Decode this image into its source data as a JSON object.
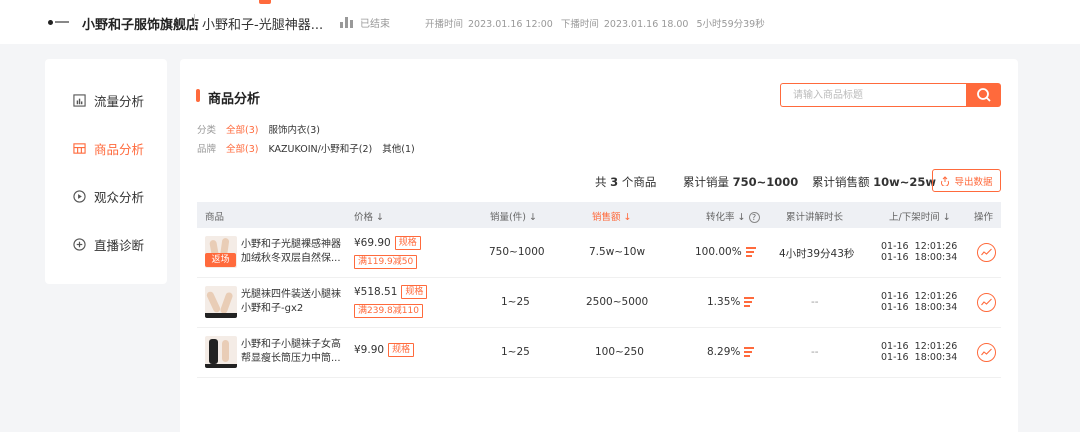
{
  "header": {
    "shop_name": "小野和子服饰旗舰店",
    "live_title": "小野和子-光腿神器...",
    "status": "已结束",
    "start_label": "开播时间",
    "start_time": "2023.01.16 12:00",
    "end_label": "下播时间",
    "end_time": "2023.01.16 18.00",
    "duration": "5小时59分39秒"
  },
  "sidebar": {
    "items": [
      {
        "label": "流量分析",
        "icon": "chart-box-icon"
      },
      {
        "label": "商品分析",
        "icon": "goods-icon",
        "active": true
      },
      {
        "label": "观众分析",
        "icon": "play-circle-icon"
      },
      {
        "label": "直播诊断",
        "icon": "plus-circle-icon"
      }
    ]
  },
  "main": {
    "title": "商品分析",
    "search_placeholder": "请输入商品标题",
    "filters": {
      "category_label": "分类",
      "category_options": [
        "全部(3)",
        "服饰内衣(3)"
      ],
      "brand_label": "品牌",
      "brand_options": [
        "全部(3)",
        "KAZUKOIN/小野和子(2)",
        "其他(1)"
      ]
    },
    "summary": {
      "total_prefix": "共",
      "total_count": "3",
      "total_suffix": "个商品",
      "sales_label": "累计销量",
      "sales_value": "750~1000",
      "amount_label": "累计销售额",
      "amount_value": "10w~25w"
    },
    "export_label": "导出数据",
    "table": {
      "columns": {
        "product": "商品",
        "price": "价格",
        "sales": "销量(件)",
        "amount": "销售额",
        "conversion": "转化率",
        "explain": "累计讲解时长",
        "shelf_time": "上/下架时间",
        "action": "操作"
      },
      "rows": [
        {
          "name_line1": "小野和子光腿裸感神器",
          "name_line2": "加绒秋冬双层自然保...",
          "back_tag": "返场",
          "price": "¥69.90",
          "spec": "规格",
          "coupon": "满119.9减50",
          "sales": "750~1000",
          "amount": "7.5w~10w",
          "conversion": "100.00%",
          "explain": "4小时39分43秒",
          "shelf_time": "01-16  12:01:26\n01-16  18:00:34"
        },
        {
          "name_line1": "光腿袜四件装送小腿袜",
          "name_line2": "小野和子-gx2",
          "price": "¥518.51",
          "spec": "规格",
          "coupon": "满239.8减110",
          "sales": "1~25",
          "amount": "2500~5000",
          "conversion": "1.35%",
          "explain": "--",
          "shelf_time": "01-16  12:01:26\n01-16  18:00:34"
        },
        {
          "name_line1": "小野和子小腿袜子女高",
          "name_line2": "帮显瘦长筒压力中筒...",
          "price": "¥9.90",
          "spec": "规格",
          "sales": "1~25",
          "amount": "100~250",
          "conversion": "8.29%",
          "explain": "--",
          "shelf_time": "01-16  12:01:26\n01-16  18:00:34"
        }
      ]
    }
  },
  "colors": {
    "accent": "#ff6a3c",
    "header_bg": "#eef0f4",
    "page_bg": "#f4f5f7"
  }
}
